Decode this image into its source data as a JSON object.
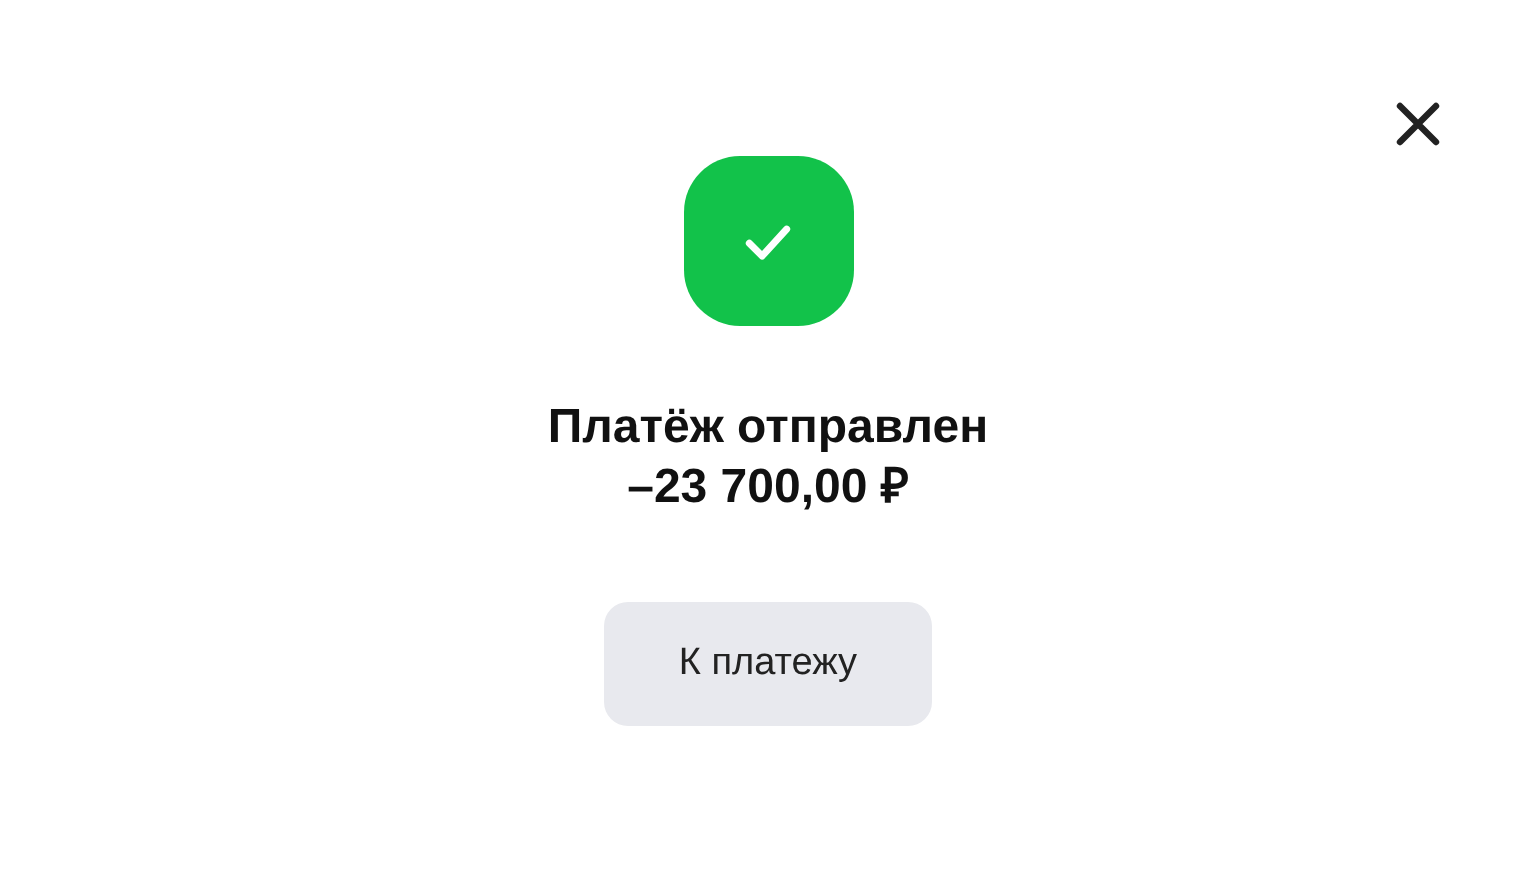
{
  "status": {
    "title": "Платёж отправлен",
    "amount": "–23 700,00 ₽"
  },
  "button": {
    "label": "К платежу"
  }
}
